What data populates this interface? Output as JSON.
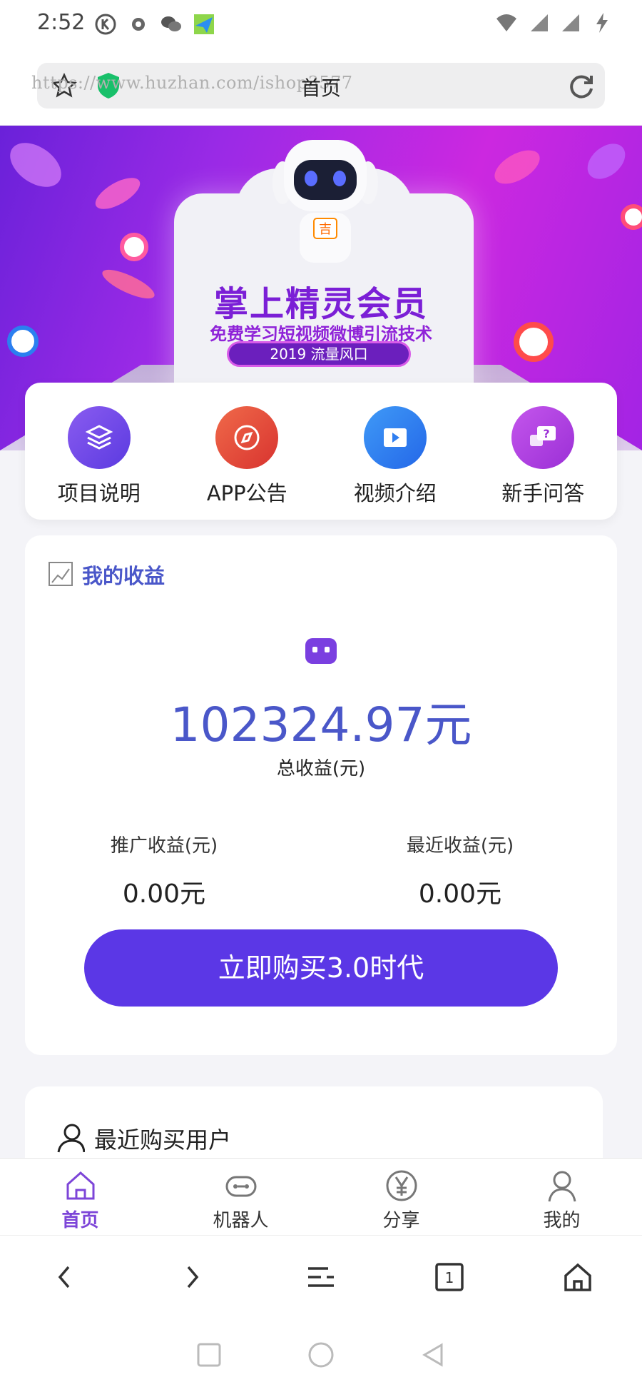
{
  "status_bar": {
    "time": "2:52"
  },
  "browser": {
    "page_title": "首页",
    "url_watermark": "https://www.huzhan.com/ishop3577"
  },
  "banner": {
    "title": "掌上精灵会员",
    "subtitle": "免费学习短视频微博引流技术",
    "pill": "2019 流量风口",
    "robot_badge": "吉"
  },
  "quick_menu": [
    {
      "label": "项目说明",
      "icon": "layers-icon",
      "color": "#7b4be8"
    },
    {
      "label": "APP公告",
      "icon": "compass-icon",
      "color": "#e64a3b"
    },
    {
      "label": "视频介绍",
      "icon": "video-icon",
      "color": "#2f7ef0"
    },
    {
      "label": "新手问答",
      "icon": "question-chat-icon",
      "color": "#b540e0"
    }
  ],
  "earnings": {
    "heading": "我的收益",
    "total_value": "102324.97元",
    "total_label": "总收益(元)",
    "promo_label": "推广收益(元)",
    "promo_value": "0.00元",
    "recent_label": "最近收益(元)",
    "recent_value": "0.00元",
    "buy_button": "立即购买3.0时代"
  },
  "recent_buyers": {
    "title": "最近购买用户"
  },
  "tabs": [
    {
      "label": "首页",
      "icon": "home-icon",
      "active": true
    },
    {
      "label": "机器人",
      "icon": "robot-icon",
      "active": false
    },
    {
      "label": "分享",
      "icon": "yen-icon",
      "active": false
    },
    {
      "label": "我的",
      "icon": "user-icon",
      "active": false
    }
  ],
  "browser_nav": {
    "tab_count": "1"
  },
  "colors": {
    "accent": "#5b37e6",
    "earnings_blue": "#4a57c9",
    "tab_active": "#7d45d8"
  }
}
